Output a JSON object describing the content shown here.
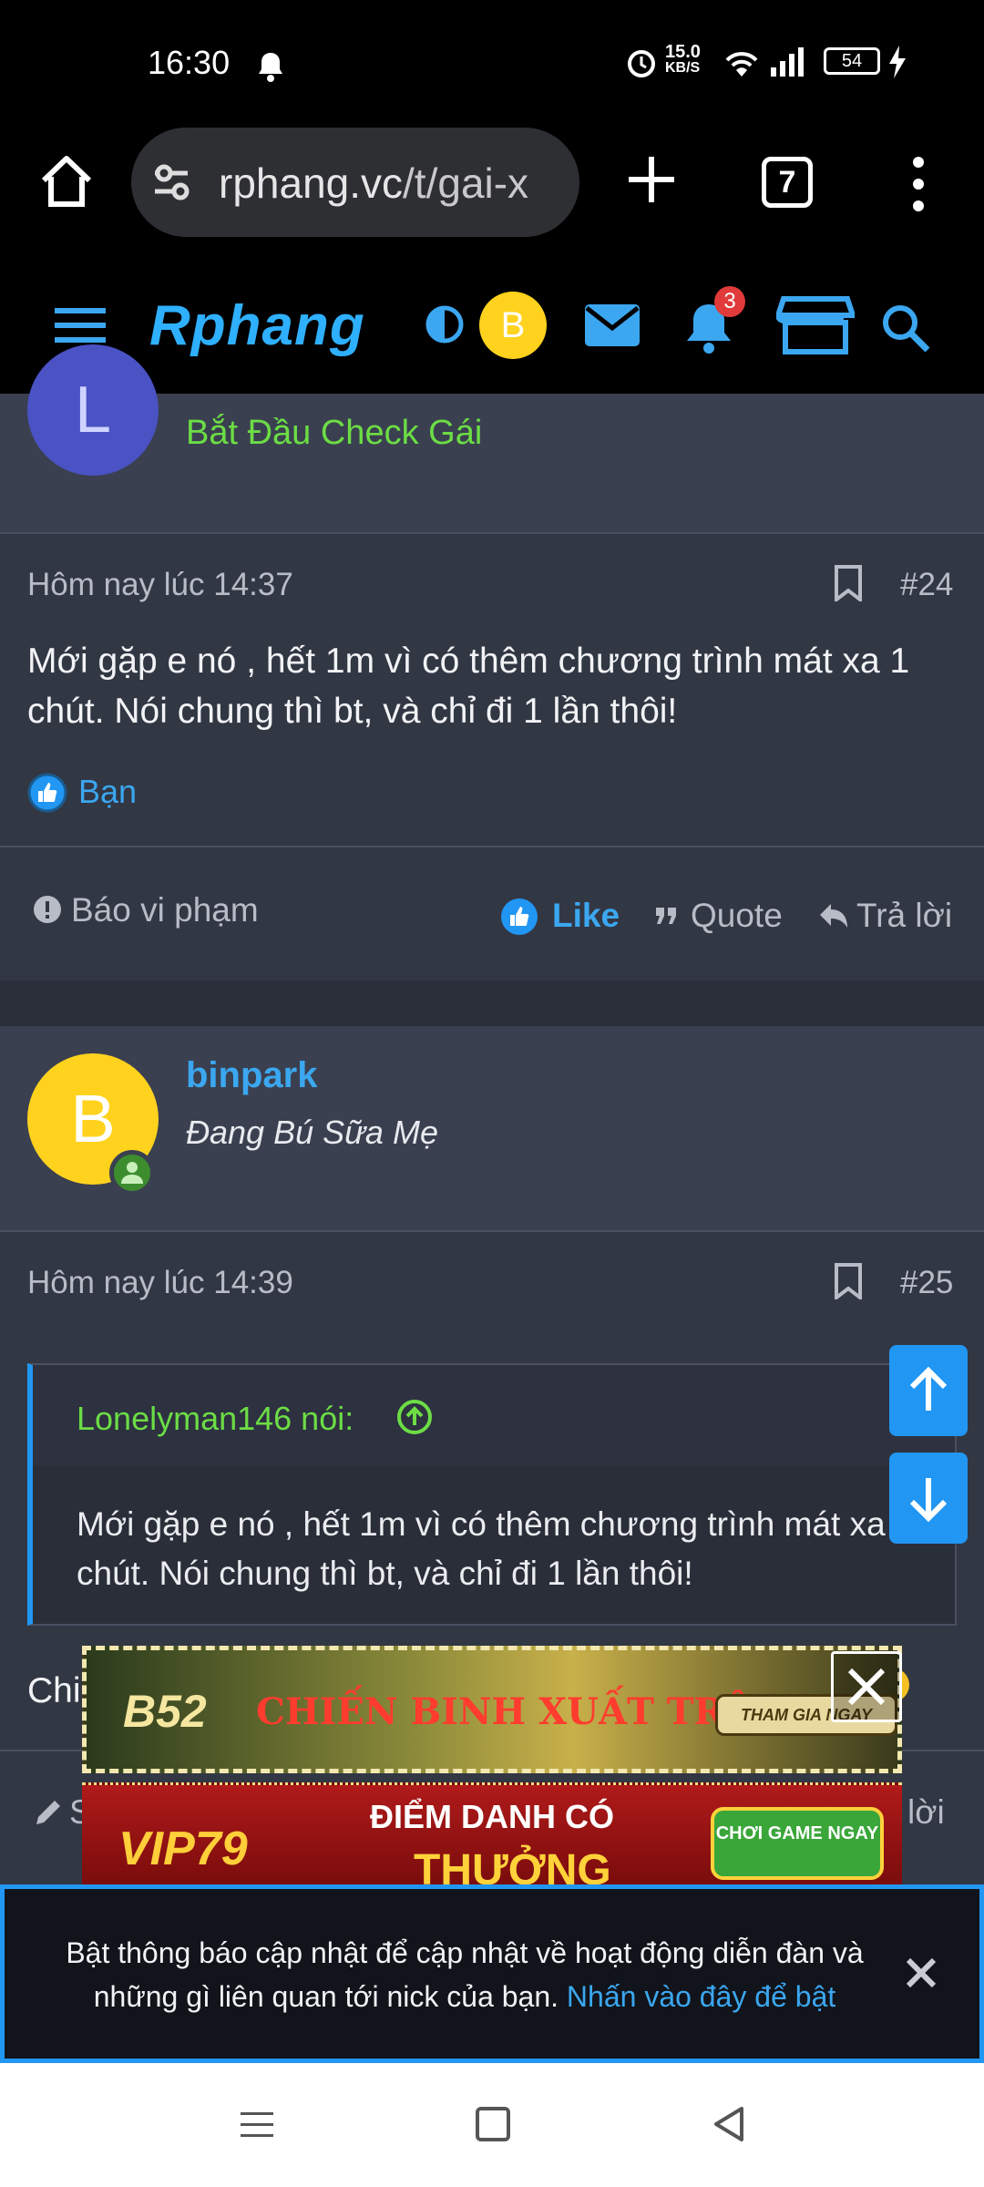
{
  "status": {
    "time": "16:30",
    "net_speed_top": "15.0",
    "net_speed_bottom": "KB/S",
    "battery": "54"
  },
  "browser": {
    "url_domain": "rphang.vc",
    "url_path": "/t/gai-x",
    "tab_count": "7"
  },
  "forum": {
    "logo_text": "Rphang",
    "avatar_letter": "B",
    "notif_count": "3"
  },
  "post_prev": {
    "user_letter": "L",
    "user_title": "Bắt Đầu Check Gái",
    "date": "Hôm nay lúc 14:37",
    "number": "#24",
    "text": "Mới gặp e nó , hết 1m vì có thêm chương trình mát xa 1 chút. Nói chung thì bt, và chỉ đi 1 lần thôi!",
    "reaction_user": "Bạn",
    "report_label": "Báo vi phạm",
    "like_label": "Like",
    "quote_label": "Quote",
    "reply_label": "Trả lời"
  },
  "post_next": {
    "user_letter": "B",
    "username": "binpark",
    "user_title": "Đang Bú Sữa Mẹ",
    "date": "Hôm nay lúc 14:39",
    "number": "#25",
    "quote_author": "Lonelyman146 nói:",
    "quote_text": "Mới gặp e nó , hết 1m vì có thêm chương trình mát xa 1 chút. Nói chung thì bt, và chỉ đi 1 lần thôi!",
    "text_visible": "Chi",
    "edit_label": "S",
    "reply_label": "lời"
  },
  "ads": {
    "ad1_brand": "B52",
    "ad1_headline": "CHIẾN BINH XUẤT TRẬN",
    "ad1_cta": "THAM GIA NGAY",
    "ad2_brand": "VIP79",
    "ad2_headline_1": "ĐIỂM DANH CÓ",
    "ad2_headline_2": "THƯỞNG",
    "ad2_cta": "CHƠI GAME NGAY"
  },
  "notification": {
    "message": "Bật thông báo cập nhật để cập nhật về hoạt động diễn đàn và những gì liên quan tới nick của bạn.",
    "link": "Nhấn vào đây để bật"
  },
  "colors": {
    "accent": "#2196f3",
    "green_title": "#6cdd45",
    "username_blue": "#3ba7f0"
  }
}
